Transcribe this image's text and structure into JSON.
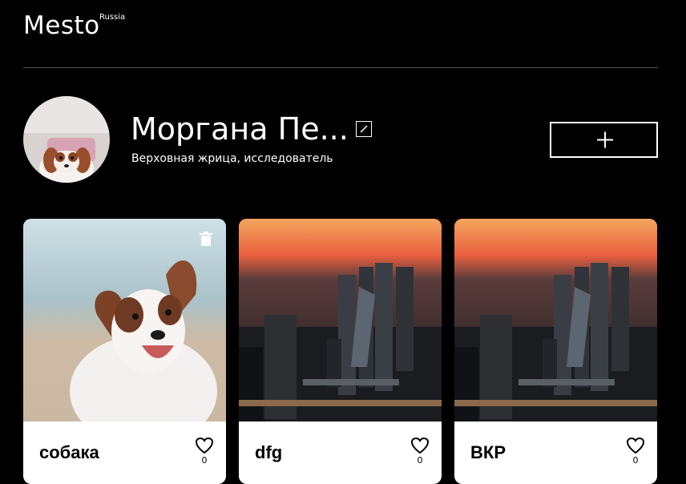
{
  "header": {
    "logo": "Mesto",
    "logo_sup": "Russia"
  },
  "profile": {
    "name": "Моргана Пе...",
    "about": "Верховная жрица, исследователь",
    "edit_icon": "pencil-icon",
    "add_icon": "plus-icon"
  },
  "cards": [
    {
      "title": "собака",
      "likes": "0",
      "image": "dog-photo",
      "deletable": true
    },
    {
      "title": "dfg",
      "likes": "0",
      "image": "moscow-city-photo",
      "deletable": false
    },
    {
      "title": "ВКР",
      "likes": "0",
      "image": "moscow-city-photo",
      "deletable": false
    }
  ]
}
